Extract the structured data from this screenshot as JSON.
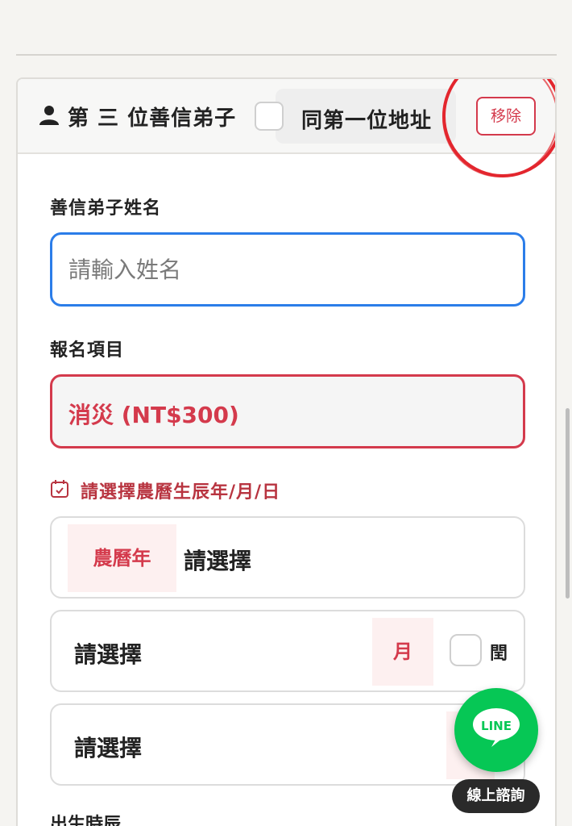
{
  "card": {
    "title": "第 三 位善信弟子",
    "same_address_label": "同第一位地址",
    "remove_label": "移除"
  },
  "form": {
    "name_label": "善信弟子姓名",
    "name_placeholder": "請輸入姓名",
    "name_value": "",
    "item_label": "報名項目",
    "item_value": "消災 (NT$300)",
    "lunar_heading": "請選擇農曆生辰年/月/日",
    "year_tag": "農曆年",
    "year_value": "請選擇",
    "month_value": "請選擇",
    "month_tag": "月",
    "leap_label": "閏",
    "day_value": "請選擇",
    "birth_time_label": "出生時辰"
  },
  "float": {
    "line_label": "LINE",
    "consult_label": "線上諮詢"
  },
  "colors": {
    "accent_red": "#d43a4c",
    "focus_blue": "#2b7de9",
    "line_green": "#06c755"
  },
  "icons": [
    "person-icon",
    "calendar-icon",
    "line-chat-icon"
  ]
}
